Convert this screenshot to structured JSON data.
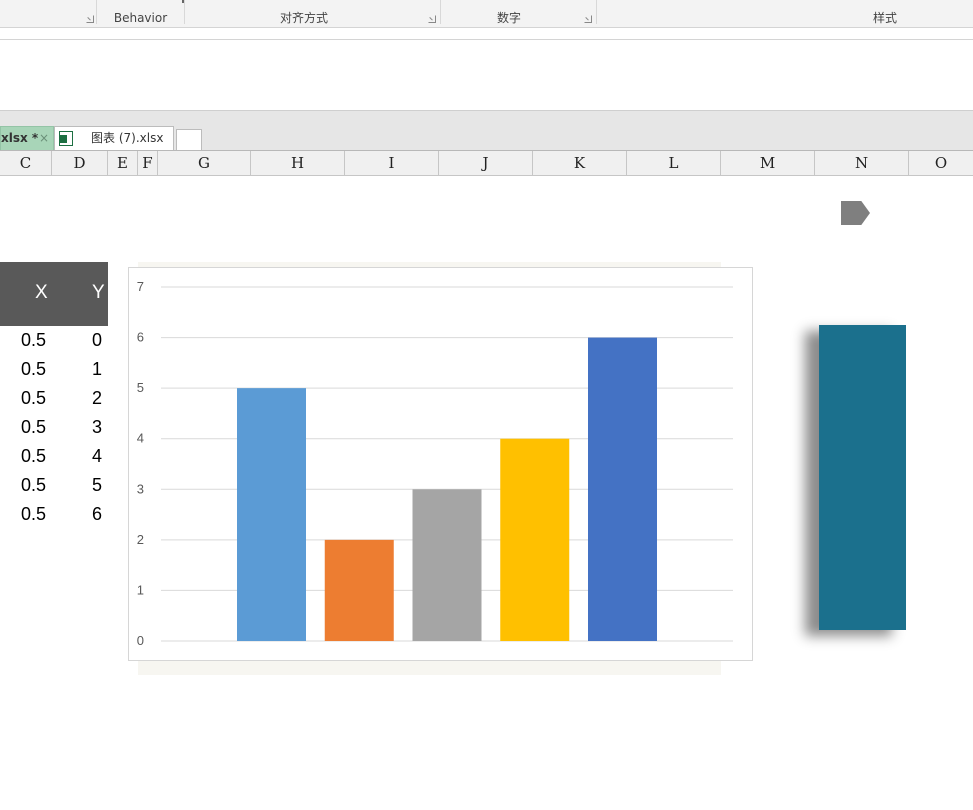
{
  "ribbon": {
    "groups": [
      {
        "label": "Behavior"
      },
      {
        "label": "对齐方式"
      },
      {
        "label": "数字"
      },
      {
        "label": "样式"
      }
    ]
  },
  "tabs": {
    "active": {
      "label": "xlsx *",
      "close": "×"
    },
    "other": {
      "label": "图表 (7).xlsx",
      "icon": "excel-file-icon"
    }
  },
  "columns": [
    "C",
    "D",
    "E",
    "F",
    "G",
    "H",
    "I",
    "J",
    "K",
    "L",
    "M",
    "N",
    "O"
  ],
  "table": {
    "headers": [
      "X",
      "Y"
    ],
    "rows": [
      [
        "0.5",
        "0"
      ],
      [
        "0.5",
        "1"
      ],
      [
        "0.5",
        "2"
      ],
      [
        "0.5",
        "3"
      ],
      [
        "0.5",
        "4"
      ],
      [
        "0.5",
        "5"
      ],
      [
        "0.5",
        "6"
      ]
    ]
  },
  "chart_data": {
    "type": "bar",
    "categories": [
      "",
      "",
      "",
      "",
      ""
    ],
    "values": [
      5,
      2,
      3,
      4,
      6
    ],
    "colors": [
      "#5b9bd5",
      "#ed7d31",
      "#a5a5a5",
      "#ffc000",
      "#4472c4"
    ],
    "title": "",
    "xlabel": "",
    "ylabel": "",
    "ylim": [
      0,
      7
    ],
    "yticks": [
      "0",
      "1",
      "2",
      "3",
      "4",
      "5",
      "6",
      "7"
    ],
    "grid": true,
    "legend": "none"
  },
  "decorations": {
    "pentagon_color": "#7f7f7f",
    "panel_color": "#1b708d"
  }
}
